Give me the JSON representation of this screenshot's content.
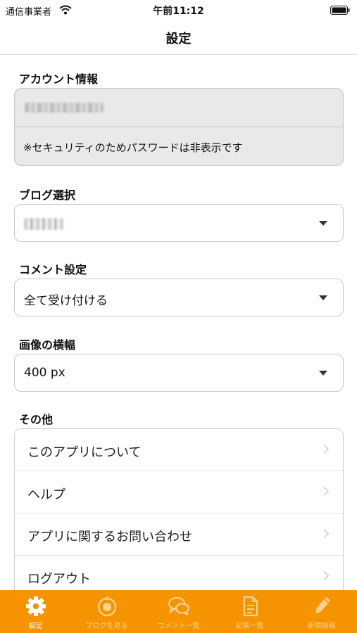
{
  "status_bar": {
    "carrier": "通信事業者",
    "time": "午前11:12"
  },
  "nav": {
    "title": "設定"
  },
  "account": {
    "heading": "アカウント情報",
    "note": "※セキュリティのためパスワードは非表示です"
  },
  "blog": {
    "heading": "ブログ選択"
  },
  "comment": {
    "heading": "コメント設定",
    "selected": "全て受け付ける"
  },
  "image_width": {
    "heading": "画像の横幅",
    "selected": "400 px"
  },
  "other": {
    "heading": "その他",
    "items": [
      {
        "label": "このアプリについて"
      },
      {
        "label": "ヘルプ"
      },
      {
        "label": "アプリに関するお問い合わせ"
      },
      {
        "label": "ログアウト"
      }
    ]
  },
  "tabs": [
    {
      "label": "設定",
      "icon": "gear-icon",
      "active": true
    },
    {
      "label": "ブログを見る",
      "icon": "target-icon",
      "active": false
    },
    {
      "label": "コメント一覧",
      "icon": "chat-bubbles-icon",
      "active": false
    },
    {
      "label": "記事一覧",
      "icon": "document-icon",
      "active": false
    },
    {
      "label": "新規投稿",
      "icon": "pencil-icon",
      "active": false
    }
  ],
  "colors": {
    "tab_bar": "#f59400",
    "inactive_tab": "#ffd08e",
    "active_tab": "#ffffff"
  }
}
